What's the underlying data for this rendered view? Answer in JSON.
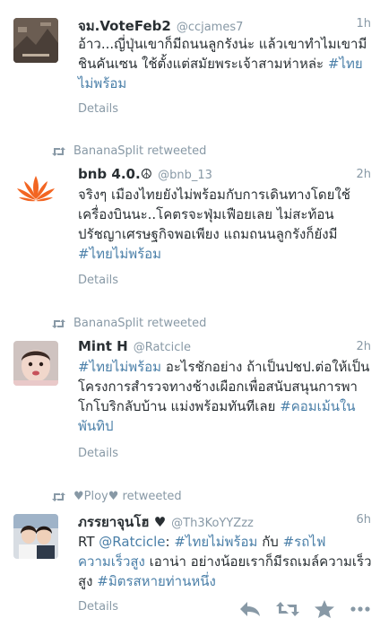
{
  "tweets": [
    {
      "fullname": "จม.VoteFeb2",
      "username": "@ccjames7",
      "time": "1h",
      "text_pre": "อ้าว...ญี่ปุ่นเขาก็มีถนนลูกรังน่ะ แล้วเขาทำไมเขามีชินคันเซน ใช้ตั้งแต่สมัยพระเจ้าสามห่าหล่ะ",
      "hashtag1": "#ไทยไม่พร้อม",
      "details": "Details"
    },
    {
      "retweeted_by": "BananaSplit retweeted",
      "fullname": "bnb 4.0.☮",
      "username": "@bnb_13",
      "time": "2h",
      "text_pre": "จริงๆ เมืองไทยยังไม่พร้อมกับการเดินทางโดยใช้เครื่องบินนะ..โคตรจะฟุ่มเฟือยเลย ไม่สะท้อนปรัชญาเศรษฐกิจพอเพียง แถมถนนลูกรังก็ยังมี",
      "hashtag1": "#ไทยไม่พร้อม",
      "details": "Details"
    },
    {
      "retweeted_by": "BananaSplit retweeted",
      "fullname": "Mint H",
      "username": "@Ratcicle",
      "time": "2h",
      "hashtag1": "#ไทยไม่พร้อม",
      "text_mid": "อะไรชักอย่าง ถ้าเป็นปชป.ต่อให้เป็นโครงการสำรวจทางช้างเผือกเพื่อสนับสนุนการพาโกโบริกลับบ้าน แม่งพร้อมทันทีเลย",
      "hashtag2": "#คอมเม้นในพันทิป",
      "details": "Details"
    },
    {
      "retweeted_by": "♥Ploy♥ retweeted",
      "fullname": "ภรรยาจุนโฮ ♥",
      "username": "@Th3KoYYZzz",
      "time": "6h",
      "rt": "RT",
      "mention": "@Ratcicle",
      "colon": ":",
      "hashtag1": "#ไทยไม่พร้อม",
      "text_mid": "กับ",
      "hashtag2": "#รถไฟความเร็วสูง",
      "text_mid2": "เอาน่า อย่างน้อยเราก็มีรถเมล์ความเร็วสูง",
      "hashtag3": "#มิตรสหายท่านหนึ่ง",
      "details": "Details"
    }
  ],
  "actions": [
    "reply-icon",
    "retweet-icon",
    "favorite-icon",
    "more-icon"
  ],
  "colors": {
    "link": "#4a7fa8",
    "muted": "#8899a6",
    "text": "#292f33",
    "lotus": "#f26522"
  }
}
